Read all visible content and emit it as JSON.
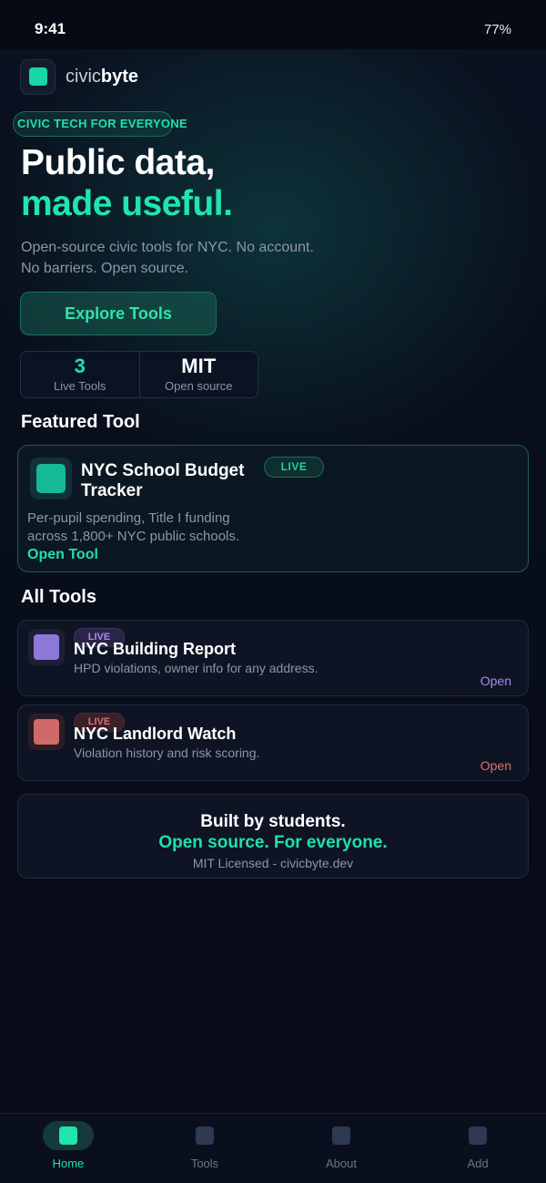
{
  "status_bar": {
    "time": "9:41",
    "battery": "77%"
  },
  "brand": {
    "prefix": "civic",
    "suffix": "byte"
  },
  "hero": {
    "eyebrow": "CIVIC TECH FOR EVERYONE",
    "title_line1": "Public data,",
    "title_line2": "made useful.",
    "subtitle_line1": "Open-source civic tools for NYC. No account.",
    "subtitle_line2": "No barriers. Open source.",
    "cta": "Explore Tools"
  },
  "stats": [
    {
      "value": "3",
      "label": "Live Tools"
    },
    {
      "value": "MIT",
      "label": "Open source"
    }
  ],
  "featured": {
    "section_title": "Featured Tool",
    "name": "NYC School Budget Tracker",
    "badge": "LIVE",
    "description": "Per-pupil spending, Title I funding across 1,800+ NYC public schools.",
    "link": "Open Tool"
  },
  "all_tools": {
    "section_title": "All Tools",
    "items": [
      {
        "name": "NYC Building Report",
        "badge": "LIVE",
        "description": "HPD violations, owner info for any address.",
        "open": "Open",
        "color": "#8c78d8",
        "icon": "building-icon"
      },
      {
        "name": "NYC Landlord Watch",
        "badge": "LIVE",
        "description": "Violation history and risk scoring.",
        "open": "Open",
        "color": "#d06a6a",
        "icon": "landlord-icon"
      }
    ]
  },
  "footer": {
    "line1": "Built by students.",
    "line2": "Open source. For everyone.",
    "line3": "MIT Licensed - civicbyte.dev"
  },
  "tabs": [
    {
      "label": "Home",
      "active": true,
      "icon": "home-icon"
    },
    {
      "label": "Tools",
      "active": false,
      "icon": "tools-icon"
    },
    {
      "label": "About",
      "active": false,
      "icon": "about-icon"
    },
    {
      "label": "Add",
      "active": false,
      "icon": "add-icon"
    }
  ],
  "colors": {
    "accent": "#1fe0ad",
    "background": "#070b17",
    "card": "#0e1424"
  }
}
